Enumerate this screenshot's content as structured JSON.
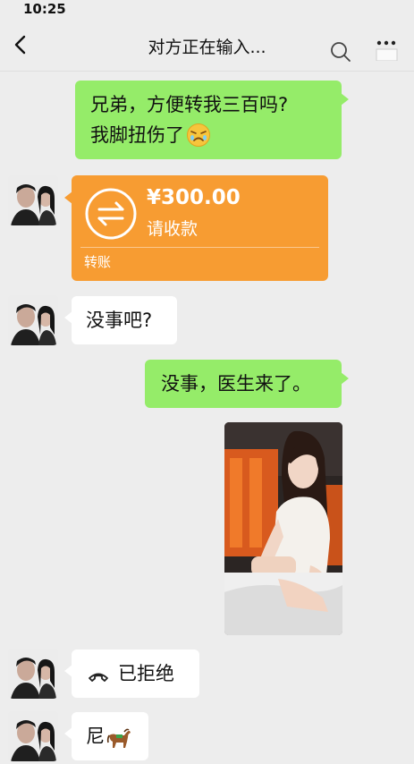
{
  "status_bar": {
    "time": "10:25"
  },
  "header": {
    "title": "对方正在输入..."
  },
  "messages": {
    "m1_line1": "兄弟，方便转我三百吗?",
    "m1_line2": "我脚扭伤了",
    "transfer": {
      "amount": "¥300.00",
      "status": "请收款",
      "footer": "转账"
    },
    "m3": "没事吧?",
    "m4": "没事，医生来了。",
    "m6": "已拒绝",
    "m7": "尼"
  },
  "colors": {
    "background": "#ededed",
    "sent_bubble": "#95ec69",
    "received_bubble": "#ffffff",
    "transfer_card": "#f79c32"
  }
}
